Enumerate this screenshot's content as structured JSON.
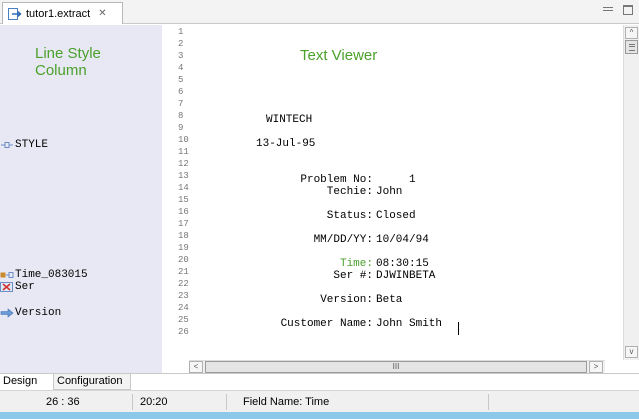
{
  "tab": {
    "title": "tutor1.extract",
    "close_glyph": "✕",
    "icon": "extract-file-icon"
  },
  "window_controls": {
    "minimize_icon": "minimize-icon",
    "maximize_icon": "maximize-icon"
  },
  "line_style_column": {
    "title_line1": "Line Style",
    "title_line2": "Column",
    "items": [
      {
        "label": "STYLE",
        "line": 10,
        "icon": "style-icon"
      },
      {
        "label": "Time_083015",
        "line": 20,
        "icon": "field-time-icon"
      },
      {
        "label": "Ser",
        "line": 21,
        "icon": "delete-field-icon"
      },
      {
        "label": "Version",
        "line": 23,
        "icon": "arrow-field-icon"
      }
    ]
  },
  "text_viewer": {
    "title": "Text Viewer",
    "line_numbers": [
      "1",
      "2",
      "3",
      "4",
      "5",
      "6",
      "7",
      "8",
      "9",
      "10",
      "11",
      "12",
      "13",
      "14",
      "15",
      "16",
      "17",
      "18",
      "19",
      "20",
      "21",
      "22",
      "23",
      "24",
      "25",
      "26"
    ],
    "lines": [
      {
        "line": 8,
        "label": "",
        "value": "WINTECH"
      },
      {
        "line": 10,
        "label": "",
        "value": "13-Jul-95"
      },
      {
        "line": 13,
        "label": "Problem No:",
        "value": "     1"
      },
      {
        "line": 14,
        "label": "Techie:",
        "value": "John"
      },
      {
        "line": 16,
        "label": "Status:",
        "value": "Closed"
      },
      {
        "line": 18,
        "label": "MM/DD/YY:",
        "value": "10/04/94"
      },
      {
        "line": 20,
        "label": "Time:",
        "value": "08:30:15",
        "highlight": true
      },
      {
        "line": 21,
        "label": "Ser #:",
        "value": "DJWINBETA"
      },
      {
        "line": 23,
        "label": "Version:",
        "value": "Beta"
      },
      {
        "line": 25,
        "label": "Customer Name:",
        "value": "John Smith"
      }
    ]
  },
  "scrollbars": {
    "up_glyph": "^",
    "down_glyph": "v",
    "left_glyph": "<",
    "right_glyph": ">",
    "h_thumb_glyph": "III"
  },
  "bottom_tabs": {
    "design": "Design",
    "configuration": "Configuration"
  },
  "status": {
    "position": "26 : 36",
    "line_col": "20:20",
    "field_name": "Field Name: Time"
  },
  "colors": {
    "accent_green": "#4aa12b",
    "column_bg": "#e8e8f4",
    "strip_blue": "#8dc8ea"
  }
}
